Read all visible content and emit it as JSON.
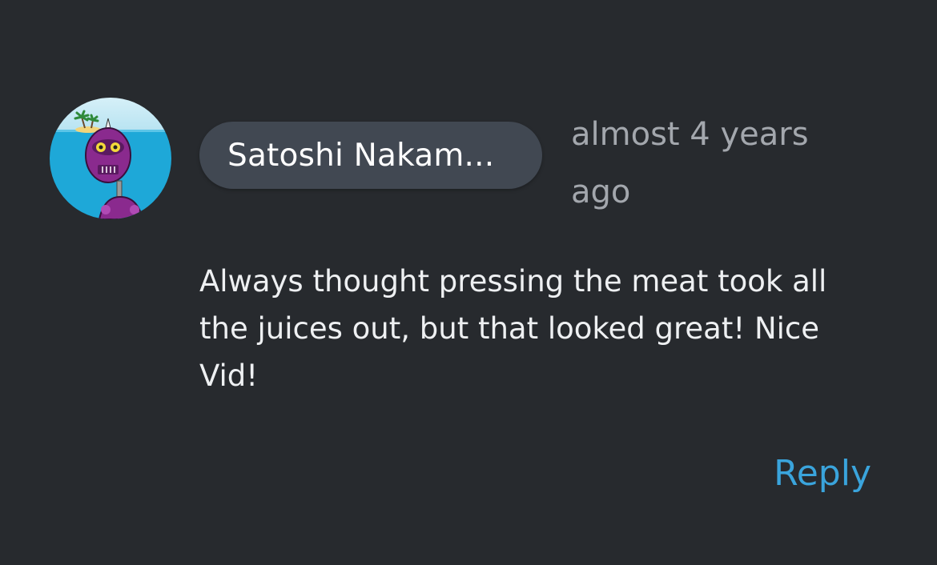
{
  "comment": {
    "author": {
      "name": "Satoshi Nakam...",
      "avatar_icon": "robot-avatar-icon"
    },
    "timestamp": "almost 4 years ago",
    "body": "Always thought pressing the meat took all the juices out, but that looked great! Nice Vid!",
    "reply_label": "Reply"
  },
  "colors": {
    "background": "#272a2e",
    "chip": "#414852",
    "reply": "#3aa4dc",
    "timestamp": "#a3a7ad"
  }
}
